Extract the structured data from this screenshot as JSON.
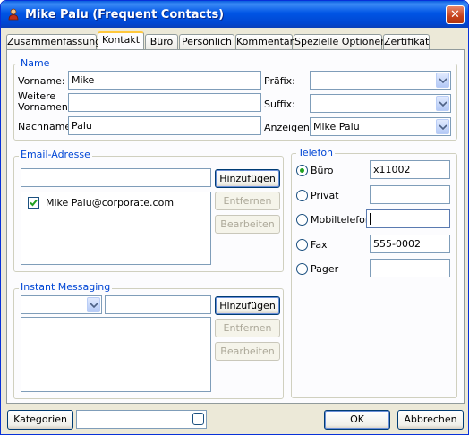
{
  "window": {
    "title": "Mike Palu (Frequent Contacts)"
  },
  "tabs": [
    {
      "label": "Zusammenfassung"
    },
    {
      "label": "Kontakt",
      "active": true
    },
    {
      "label": "Büro"
    },
    {
      "label": "Persönlich"
    },
    {
      "label": "Kommentar"
    },
    {
      "label": "Spezielle Optionen"
    },
    {
      "label": "Zertifikat"
    }
  ],
  "name_section": {
    "legend": "Name",
    "vorname_label": "Vorname:",
    "vorname_value": "Mike",
    "weitere_label_1": "Weitere",
    "weitere_label_2": "Vornamen:",
    "weitere_value": "",
    "nachname_label": "Nachname:",
    "nachname_value": "Palu",
    "praefix_label": "Präfix:",
    "praefix_value": "",
    "suffix_label": "Suffix:",
    "suffix_value": "",
    "anzeigen_label": "Anzeigen:",
    "anzeigen_value": "Mike Palu"
  },
  "email_section": {
    "legend": "Email-Adresse",
    "input_value": "",
    "add_button": "Hinzufügen",
    "remove_button": "Entfernen",
    "edit_button": "Bearbeiten",
    "items": [
      {
        "address": "Mike Palu@corporate.com",
        "checked": true
      }
    ]
  },
  "im_section": {
    "legend": "Instant Messaging",
    "service_value": "",
    "input_value": "",
    "add_button": "Hinzufügen",
    "remove_button": "Entfernen",
    "edit_button": "Bearbeiten"
  },
  "phone_section": {
    "legend": "Telefon",
    "rows": [
      {
        "label": "Büro",
        "value": "x11002",
        "selected": true
      },
      {
        "label": "Privat",
        "value": "",
        "selected": false
      },
      {
        "label": "Mobiltelefon",
        "value": "",
        "selected": false
      },
      {
        "label": "Fax",
        "value": "555-0002",
        "selected": false
      },
      {
        "label": "Pager",
        "value": "",
        "selected": false
      }
    ]
  },
  "footer": {
    "categories_button": "Kategorien",
    "categories_value": "",
    "ok_button": "OK",
    "cancel_button": "Abbrechen"
  },
  "colors": {
    "title_bar": "#0055e5",
    "group_legend": "#0046d5",
    "tab_highlight": "#ffc83c",
    "radio_selected": "#21a121"
  }
}
